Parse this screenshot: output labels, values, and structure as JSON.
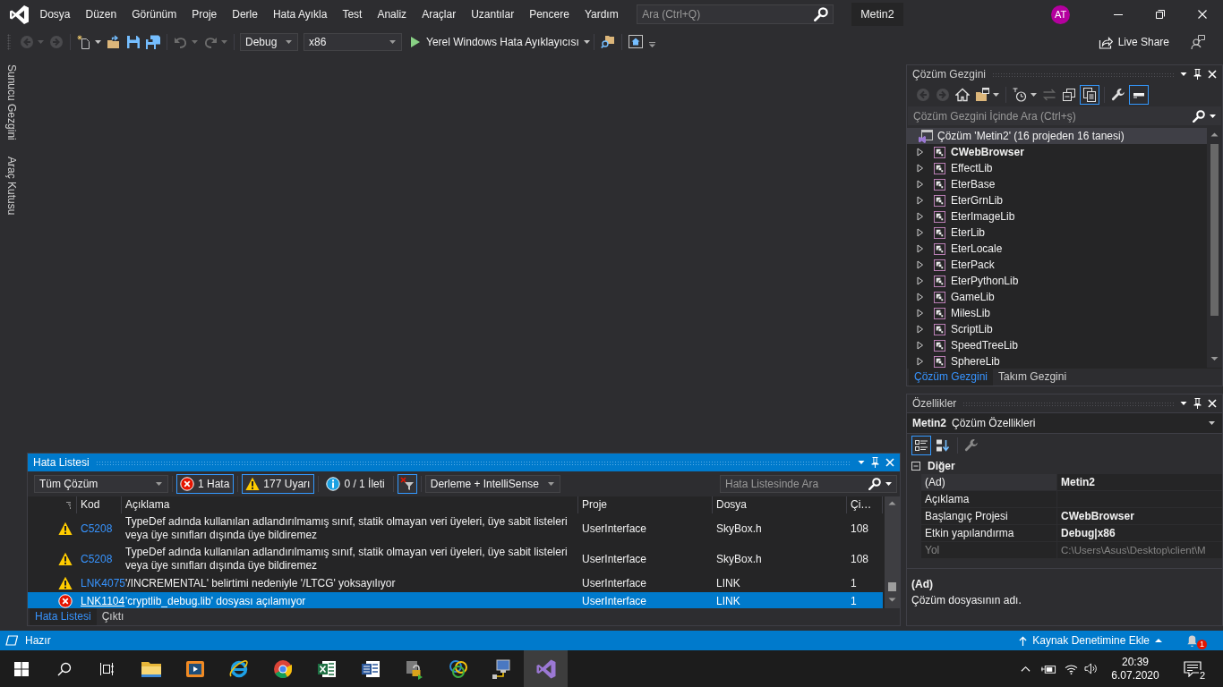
{
  "title_bar": {
    "menu": [
      "Dosya",
      "Düzen",
      "Görünüm",
      "Proje",
      "Derle",
      "Hata Ayıkla",
      "Test",
      "Analiz",
      "Araçlar",
      "Uzantılar",
      "Pencere",
      "Yardım"
    ],
    "search": {
      "placeholder": "Ara (Ctrl+Q)"
    },
    "solution_name": "Metin2",
    "account_initials": "AT"
  },
  "toolbar": {
    "configuration": "Debug",
    "platform": "x86",
    "start_debugger": "Yerel Windows Hata Ayıklayıcısı",
    "live_share": "Live Share"
  },
  "side_tabs": [
    "Sunucu Gezgini",
    "Araç Kutusu"
  ],
  "error_list": {
    "title": "Hata Listesi",
    "active": true,
    "scope": "Tüm Çözüm",
    "filters": [
      {
        "kind": "error",
        "label": "1 Hata",
        "selected": true
      },
      {
        "kind": "warning",
        "label": "177 Uyarı",
        "selected": true
      },
      {
        "kind": "message",
        "label": "0 / 1 İleti",
        "selected": false
      }
    ],
    "filter_button": {
      "on": true
    },
    "source": "Derleme + IntelliSense",
    "search": {
      "placeholder": "Hata Listesinde Ara"
    },
    "columns": [
      "Kod",
      "Açıklama",
      "Proje",
      "Dosya",
      "Çi…"
    ],
    "rows": [
      {
        "kind": "warning",
        "code": "C5208",
        "description": "TypeDef adında kullanılan adlandırılmamış sınıf, statik olmayan veri üyeleri, üye sabit listeleri veya üye sınıfları dışında üye bildiremez",
        "project": "UserInterface",
        "file": "SkyBox.h",
        "line": "108",
        "selected": false
      },
      {
        "kind": "warning",
        "code": "C5208",
        "description": "TypeDef adında kullanılan adlandırılmamış sınıf, statik olmayan veri üyeleri, üye sabit listeleri veya üye sınıfları dışında üye bildiremez",
        "project": "UserInterface",
        "file": "SkyBox.h",
        "line": "108",
        "selected": false
      },
      {
        "kind": "warning",
        "code": "LNK4075",
        "description": "'/INCREMENTAL' belirtimi nedeniyle '/LTCG' yoksayılıyor",
        "project": "UserInterface",
        "file": "LINK",
        "line": "1",
        "selected": false
      },
      {
        "kind": "error",
        "code": "LNK1104",
        "description": "'cryptlib_debug.lib' dosyası açılamıyor",
        "project": "UserInterface",
        "file": "LINK",
        "line": "1",
        "selected": true
      }
    ],
    "tabs": [
      {
        "label": "Hata Listesi",
        "selected": true
      },
      {
        "label": "Çıktı",
        "selected": false
      }
    ]
  },
  "solution_explorer": {
    "title": "Çözüm Gezgini",
    "active": false,
    "toggles": [
      {
        "on": true
      },
      {
        "on": true
      }
    ],
    "search": {
      "placeholder": "Çözüm Gezgini İçinde Ara (Ctrl+ş)"
    },
    "tree": {
      "label": "Çözüm 'Metin2' (16 projeden 16 tanesi)",
      "selected": true,
      "children": [
        {
          "label": "CWebBrowser",
          "startup": true,
          "expanded": false,
          "selected": false
        },
        {
          "label": "EffectLib",
          "startup": false,
          "expanded": false,
          "selected": false
        },
        {
          "label": "EterBase",
          "startup": false,
          "expanded": false,
          "selected": false
        },
        {
          "label": "EterGrnLib",
          "startup": false,
          "expanded": false,
          "selected": false
        },
        {
          "label": "EterImageLib",
          "startup": false,
          "expanded": false,
          "selected": false
        },
        {
          "label": "EterLib",
          "startup": false,
          "expanded": false,
          "selected": false
        },
        {
          "label": "EterLocale",
          "startup": false,
          "expanded": false,
          "selected": false
        },
        {
          "label": "EterPack",
          "startup": false,
          "expanded": false,
          "selected": false
        },
        {
          "label": "EterPythonLib",
          "startup": false,
          "expanded": false,
          "selected": false
        },
        {
          "label": "GameLib",
          "startup": false,
          "expanded": false,
          "selected": false
        },
        {
          "label": "MilesLib",
          "startup": false,
          "expanded": false,
          "selected": false
        },
        {
          "label": "ScriptLib",
          "startup": false,
          "expanded": false,
          "selected": false
        },
        {
          "label": "SpeedTreeLib",
          "startup": false,
          "expanded": false,
          "selected": false
        },
        {
          "label": "SphereLib",
          "startup": false,
          "expanded": false,
          "selected": false
        }
      ]
    },
    "tabs": [
      {
        "label": "Çözüm Gezgini",
        "selected": true
      },
      {
        "label": "Takım Gezgini",
        "selected": false
      }
    ]
  },
  "properties": {
    "title": "Özellikler",
    "active": false,
    "object_name": "Metin2",
    "object_type": "Çözüm Özellikleri",
    "view_buttons": [
      {
        "selected": true
      },
      {
        "selected": false
      }
    ],
    "group": {
      "label": "Diğer",
      "expanded": true,
      "rows": [
        {
          "name": "(Ad)",
          "value": "Metin2",
          "modified": true,
          "read_only": false,
          "selected": true
        },
        {
          "name": "Açıklama",
          "read_only": false,
          "selected": false
        },
        {
          "name": "Başlangıç Projesi",
          "value": "CWebBrowser",
          "modified": true,
          "read_only": false,
          "selected": false
        },
        {
          "name": "Etkin yapılandırma",
          "value": "Debug|x86",
          "modified": true,
          "read_only": false,
          "selected": false
        },
        {
          "name": "Yol",
          "value": "C:\\Users\\Asus\\Desktop\\client\\M",
          "modified": false,
          "read_only": true,
          "selected": false
        }
      ]
    },
    "description_title": "(Ad)",
    "description": "Çözüm dosyasının adı."
  },
  "status_bar": {
    "text": "Hazır",
    "source_control": "Kaynak Denetimine Ekle",
    "notifications": "1"
  },
  "taskbar": {
    "apps": [
      {
        "selected": false
      },
      {
        "selected": false
      },
      {
        "selected": false
      },
      {
        "selected": false
      },
      {
        "selected": false
      },
      {
        "selected": false
      },
      {
        "selected": false
      },
      {
        "selected": false
      },
      {
        "selected": false
      },
      {
        "selected": true
      }
    ],
    "time": "20:39",
    "date": "6.07.2020",
    "notifications": "2"
  }
}
